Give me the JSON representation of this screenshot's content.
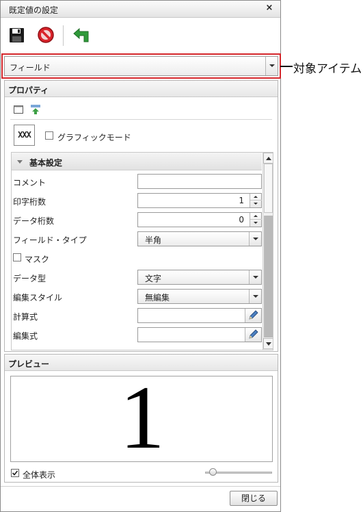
{
  "dialog": {
    "title": "既定値の設定",
    "close_glyph": "×"
  },
  "toolbar": {
    "save_icon": "save-icon",
    "cancel_icon": "no-entry-icon",
    "back_icon": "back-arrow-icon"
  },
  "target": {
    "value": "フィールド",
    "callout": "対象アイテム",
    "highlight_color": "#d4262b"
  },
  "properties": {
    "title": "プロパティ",
    "sample_text": "XXX",
    "graphic_mode_label": "グラフィックモード",
    "graphic_mode_checked": false,
    "section": "基本設定",
    "rows": {
      "comment": {
        "label": "コメント",
        "value": ""
      },
      "print_digits": {
        "label": "印字桁数",
        "value": "1"
      },
      "data_digits": {
        "label": "データ桁数",
        "value": "0"
      },
      "field_type": {
        "label": "フィールド・タイプ",
        "value": "半角"
      },
      "mask": {
        "label": "マスク",
        "checked": false
      },
      "data_type": {
        "label": "データ型",
        "value": "文字"
      },
      "edit_style": {
        "label": "編集スタイル",
        "value": "無編集"
      },
      "calc_expr": {
        "label": "計算式",
        "value": ""
      },
      "edit_expr": {
        "label": "編集式",
        "value": ""
      }
    }
  },
  "preview": {
    "title": "プレビュー",
    "content": "1",
    "show_all_label": "全体表示",
    "show_all_checked": true,
    "zoom_level": 0.12
  },
  "footer": {
    "close_label": "閉じる"
  }
}
